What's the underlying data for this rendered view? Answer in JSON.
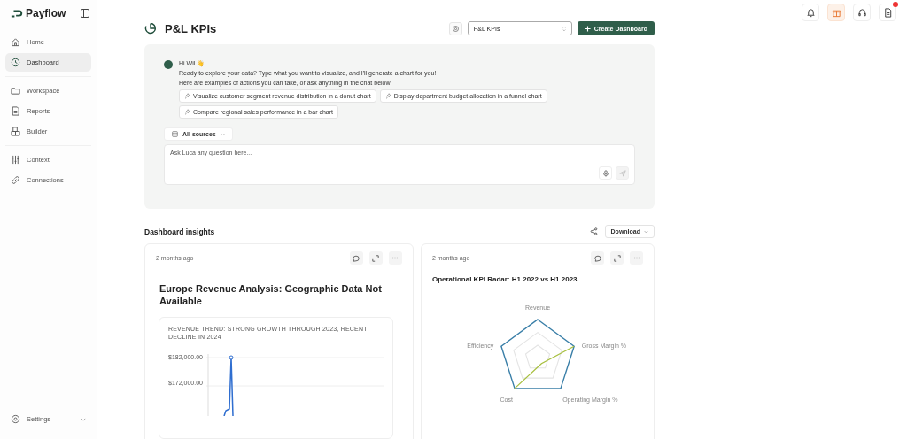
{
  "brand": "Payflow",
  "nav": [
    {
      "label": "Home",
      "selected": false
    },
    {
      "label": "Dashboard",
      "selected": true
    },
    {
      "label": "Workspace",
      "selected": false
    },
    {
      "label": "Reports",
      "selected": false
    },
    {
      "label": "Builder",
      "selected": false
    },
    {
      "label": "Context",
      "selected": false
    },
    {
      "label": "Connections",
      "selected": false
    }
  ],
  "settings": "Settings",
  "notification_dot": true,
  "page_title": "P&L KPIs",
  "dashboard_select": "P&L KPIs",
  "create_button": "Create Dashboard",
  "assistant": {
    "greeting": "Hi Wil 👋",
    "intro": "Ready to explore your data? Type what you want to visualize, and I'll generate a chart for you!",
    "hint": "Here are examples of actions you can take, or ask anything in the chat below",
    "suggestions": [
      "Visualize customer segment revenue distribution in a donut chart",
      "Display department budget allocation in a funnel chart",
      "Compare regional sales performance in a bar chart"
    ],
    "sources": "All sources",
    "placeholder": "Ask Luca any question here..."
  },
  "insights_title": "Dashboard insights",
  "download": "Download",
  "cards": [
    {
      "kind": "line",
      "time": "2 months ago",
      "title": "Europe Revenue Analysis: Geographic Data Not Available",
      "subtitle": "REVENUE TREND: STRONG GROWTH THROUGH 2023, RECENT DECLINE IN 2024",
      "tick_labels": [
        "$182,000.00",
        "$172,000.00"
      ]
    },
    {
      "kind": "radar",
      "time": "2 months ago",
      "title": "Operational KPI Radar: H1 2022 vs H1 2023",
      "axes": [
        "Revenue",
        "Efficiency",
        "Gross Margin %",
        "Cost",
        "Operating Margin %"
      ]
    }
  ]
}
